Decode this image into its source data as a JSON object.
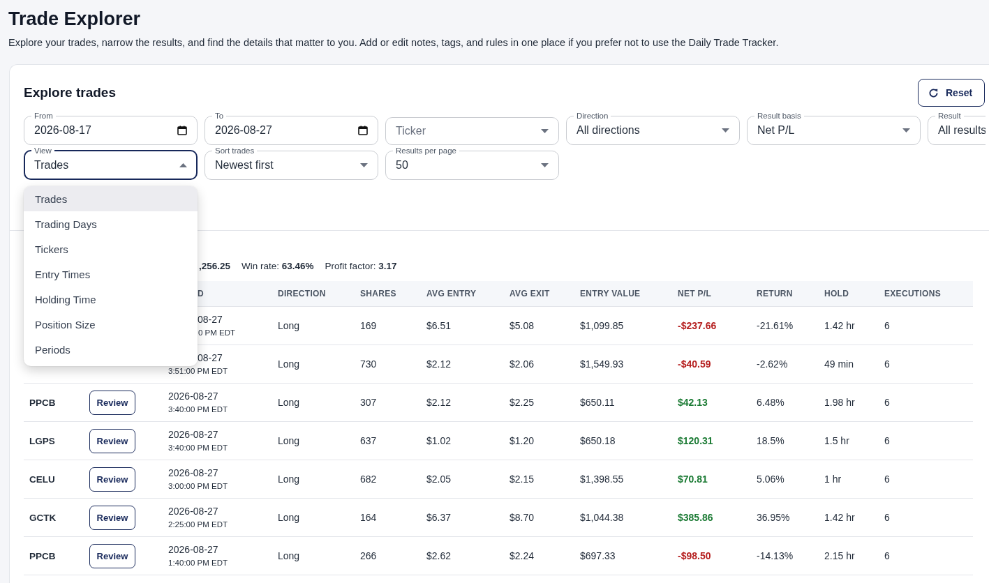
{
  "page": {
    "title": "Trade Explorer",
    "subtitle": "Explore your trades, narrow the results, and find the details that matter to you. Add or edit notes, tags, and rules in one place if you prefer not to use the Daily Trade Tracker."
  },
  "panel": {
    "title": "Explore trades",
    "reset_label": "Reset"
  },
  "filters": [
    {
      "kind": "date",
      "label": "From",
      "value": "2026-08-17",
      "open": false
    },
    {
      "kind": "date",
      "label": "To",
      "value": "2026-08-27",
      "open": false
    },
    {
      "kind": "select",
      "placeholder": "Ticker",
      "open": false
    },
    {
      "kind": "select",
      "label": "Direction",
      "value": "All directions",
      "open": false
    },
    {
      "kind": "select",
      "label": "Result basis",
      "value": "Net P/L",
      "open": false
    },
    {
      "kind": "cut",
      "label": "Result",
      "value": "All results",
      "open": false
    },
    {
      "kind": "select",
      "label": "View",
      "value": "Trades",
      "open": true
    },
    {
      "kind": "select",
      "label": "Sort trades",
      "value": "Newest first",
      "open": false
    },
    {
      "kind": "select",
      "label": "Results per page",
      "value": "50",
      "open": false
    }
  ],
  "view_menu": [
    {
      "label": "Trades",
      "selected": true
    },
    {
      "label": "Trading Days",
      "selected": false
    },
    {
      "label": "Tickers",
      "selected": false
    },
    {
      "label": "Entry Times",
      "selected": false
    },
    {
      "label": "Holding Time",
      "selected": false
    },
    {
      "label": "Position Size",
      "selected": false
    },
    {
      "label": "Periods",
      "selected": false
    }
  ],
  "summary": [
    {
      "value": ",256.25",
      "covered": true
    },
    {
      "label": "Win rate:",
      "value": "63.46%",
      "covered": false
    },
    {
      "label": "Profit factor:",
      "value": "3.17",
      "covered": false
    }
  ],
  "table": {
    "columns": [
      {
        "label": "D",
        "covered": true
      },
      {
        "label": "DIRECTION",
        "covered": false
      },
      {
        "label": "SHARES",
        "covered": false
      },
      {
        "label": "AVG ENTRY",
        "covered": false
      },
      {
        "label": "AVG EXIT",
        "covered": false
      },
      {
        "label": "ENTRY VALUE",
        "covered": false
      },
      {
        "label": "NET P/L",
        "covered": false
      },
      {
        "label": "RETURN",
        "covered": false
      },
      {
        "label": "HOLD",
        "covered": false
      },
      {
        "label": "EXECUTIONS",
        "covered": false
      }
    ],
    "rows": [
      {
        "date": "08-27",
        "date_covered": true,
        "time": "0 PM EDT",
        "time_covered": true,
        "direction": "Long",
        "shares": "169",
        "avg_entry": "$6.51",
        "avg_exit": "$5.08",
        "entry_value": "$1,099.85",
        "net_pl": "-$237.66",
        "color": "#b51e1e",
        "return": "-21.61%",
        "hold": "1.42 hr",
        "executions": "6"
      },
      {
        "date": "08-27",
        "date_covered": true,
        "time": "3:51:00 PM EDT",
        "time_covered": false,
        "direction": "Long",
        "shares": "730",
        "avg_entry": "$2.12",
        "avg_exit": "$2.06",
        "entry_value": "$1,549.93",
        "net_pl": "-$40.59",
        "color": "#b51e1e",
        "return": "-2.62%",
        "hold": "49 min",
        "executions": "6"
      },
      {
        "ticker": "PPCB",
        "review": "Review",
        "date": "2026-08-27",
        "date_covered": false,
        "time": "3:40:00 PM EDT",
        "time_covered": false,
        "direction": "Long",
        "shares": "307",
        "avg_entry": "$2.12",
        "avg_exit": "$2.25",
        "entry_value": "$650.11",
        "net_pl": "$42.13",
        "color": "#1a7a33",
        "return": "6.48%",
        "hold": "1.98 hr",
        "executions": "6"
      },
      {
        "ticker": "LGPS",
        "review": "Review",
        "date": "2026-08-27",
        "date_covered": false,
        "time": "3:40:00 PM EDT",
        "time_covered": false,
        "direction": "Long",
        "shares": "637",
        "avg_entry": "$1.02",
        "avg_exit": "$1.20",
        "entry_value": "$650.18",
        "net_pl": "$120.31",
        "color": "#1a7a33",
        "return": "18.5%",
        "hold": "1.5 hr",
        "executions": "6"
      },
      {
        "ticker": "CELU",
        "review": "Review",
        "date": "2026-08-27",
        "date_covered": false,
        "time": "3:00:00 PM EDT",
        "time_covered": false,
        "direction": "Long",
        "shares": "682",
        "avg_entry": "$2.05",
        "avg_exit": "$2.15",
        "entry_value": "$1,398.55",
        "net_pl": "$70.81",
        "color": "#1a7a33",
        "return": "5.06%",
        "hold": "1 hr",
        "executions": "6"
      },
      {
        "ticker": "GCTK",
        "review": "Review",
        "date": "2026-08-27",
        "date_covered": false,
        "time": "2:25:00 PM EDT",
        "time_covered": false,
        "direction": "Long",
        "shares": "164",
        "avg_entry": "$6.37",
        "avg_exit": "$8.70",
        "entry_value": "$1,044.38",
        "net_pl": "$385.86",
        "color": "#1a7a33",
        "return": "36.95%",
        "hold": "1.42 hr",
        "executions": "6"
      },
      {
        "ticker": "PPCB",
        "review": "Review",
        "date": "2026-08-27",
        "date_covered": false,
        "time": "1:40:00 PM EDT",
        "time_covered": false,
        "direction": "Long",
        "shares": "266",
        "avg_entry": "$2.62",
        "avg_exit": "$2.24",
        "entry_value": "$697.33",
        "net_pl": "-$98.50",
        "color": "#b51e1e",
        "return": "-14.13%",
        "hold": "2.15 hr",
        "executions": "6"
      }
    ]
  }
}
